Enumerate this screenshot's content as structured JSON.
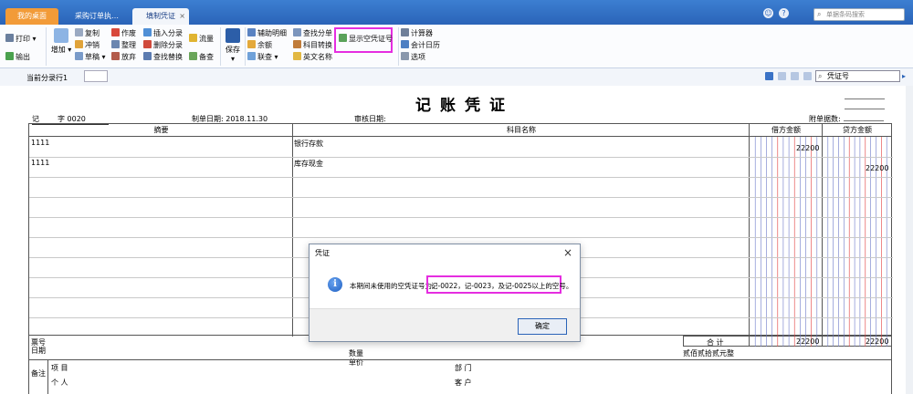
{
  "tabs": [
    {
      "label": "我的桌面"
    },
    {
      "label": "采购订单执…"
    },
    {
      "label": "填制凭证"
    }
  ],
  "topbar": {
    "barcode_placeholder": "单据条码搜索"
  },
  "ribbon": {
    "print": "打印",
    "export": "输出",
    "add": "增加",
    "copy": "复制",
    "reverse": "冲销",
    "draft": "草稿",
    "void": "作废",
    "tidy": "整理",
    "abandon": "放弃",
    "insert_split": "插入分录",
    "delete_split": "删除分录",
    "find_replace": "查找替换",
    "flow": "流量",
    "memo": "备查",
    "save": "保存",
    "aux_detail": "辅助明细",
    "balance": "余额",
    "linked_query": "联查",
    "find_split": "查找分单",
    "subject_convert": "科目转换",
    "english_name": "英文名称",
    "show_empty": "显示空凭证号",
    "calculator": "计算器",
    "calendar": "会计日历",
    "options": "选项"
  },
  "subbar": {
    "current_row": "当前分录行1",
    "voucher_search": "凭证号"
  },
  "voucher": {
    "title": "记账凭证",
    "type_prefix": "记",
    "number": "字 0020",
    "made_date_label": "制单日期:",
    "made_date": "2018.11.30",
    "audit_date_label": "审核日期:",
    "attachments_label": "附单据数:",
    "col_summary": "摘要",
    "col_subject": "科目名称",
    "col_debit": "借方金额",
    "col_credit": "贷方金额",
    "rows": [
      {
        "summary": "1111",
        "subject": "银行存款",
        "debit": "22200",
        "credit": ""
      },
      {
        "summary": "1111",
        "subject": "库存现金",
        "debit": "",
        "credit": "22200"
      }
    ],
    "ticket_no": "票号",
    "date": "日期",
    "quantity": "数量",
    "unit_price": "单价",
    "total_label": "合 计",
    "total_debit": "22200",
    "total_credit": "22200",
    "amount_words": "贰佰贰拾贰元整",
    "remark": "备注",
    "project": "项 目",
    "department": "部 门",
    "person": "个 人",
    "customer": "客 户"
  },
  "dialog": {
    "title": "凭证",
    "message": "本期间未使用的空凭证号为：",
    "value": "记-0022，记-0023，及记-0025以上的空号。",
    "ok": "确定"
  }
}
